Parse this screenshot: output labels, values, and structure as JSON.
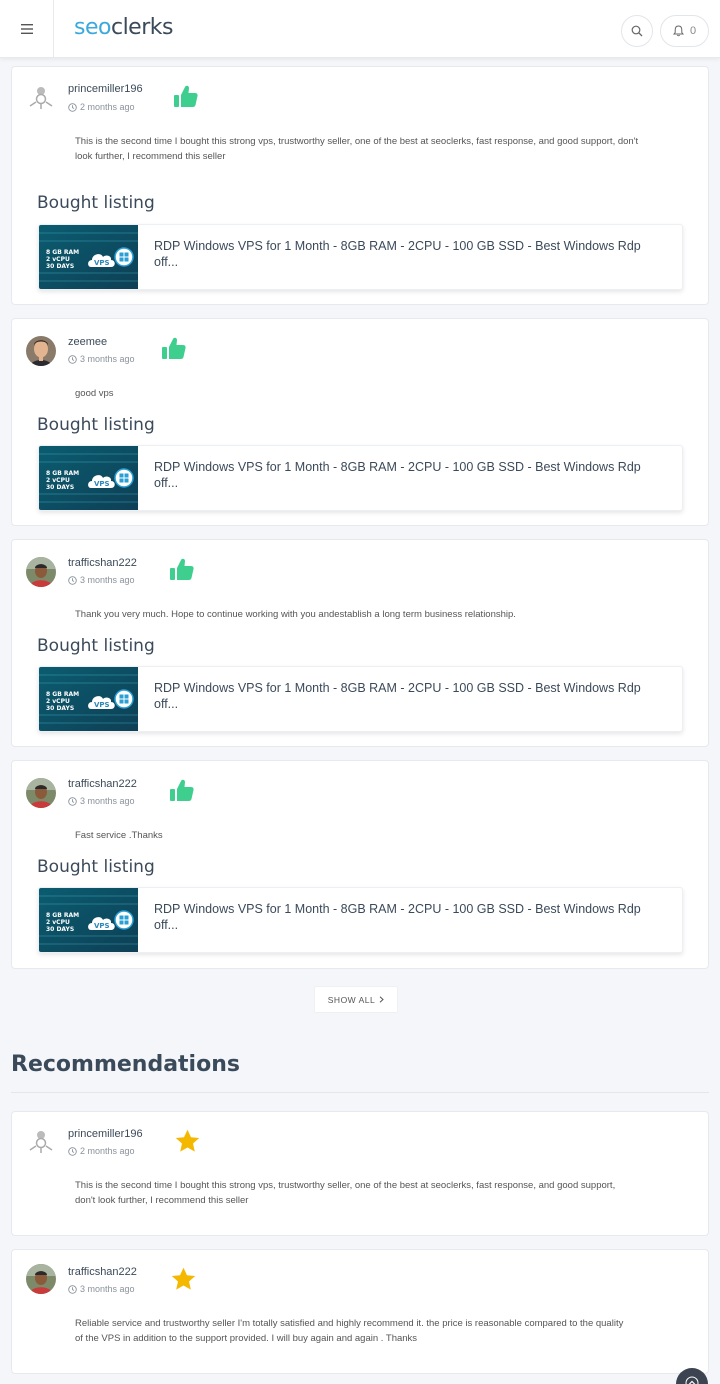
{
  "header": {
    "logo_seo": "seo",
    "logo_clerks": "clerks",
    "notification_count": "0",
    "menu_icon": "hamburger-icon",
    "search_icon": "search-icon",
    "bell_icon": "bell-icon"
  },
  "reviews": [
    {
      "username": "princemiller196",
      "time": "2 months ago",
      "text_line1": "This is the second time I bought this strong vps, trustworthy seller, one of the best at seoclerks, fast response, and good support, don't",
      "text_line2": "look further, I recommend this seller",
      "bought_label": "Bought listing",
      "listing_title": "RDP Windows VPS for 1 Month - 8GB RAM - 2CPU - 100 GB SSD - Best Windows Rdp off..."
    },
    {
      "username": "zeemee",
      "time": "3 months ago",
      "text_line1": "good vps",
      "bought_label": "Bought listing",
      "listing_title": "RDP Windows VPS for 1 Month - 8GB RAM - 2CPU - 100 GB SSD - Best Windows Rdp off..."
    },
    {
      "username": "trafficshan222",
      "time": "3 months ago",
      "text_line1": "Thank you very much. Hope to continue working with you andestablish a long term business relationship.",
      "bought_label": "Bought listing",
      "listing_title": "RDP Windows VPS for 1 Month - 8GB RAM - 2CPU - 100 GB SSD - Best Windows Rdp off..."
    },
    {
      "username": "trafficshan222",
      "time": "3 months ago",
      "text_line1": "Fast service .Thanks",
      "bought_label": "Bought listing",
      "listing_title": "RDP Windows VPS for 1 Month - 8GB RAM - 2CPU - 100 GB SSD - Best Windows Rdp off..."
    }
  ],
  "listing_thumb": {
    "ram": "8 GB RAM",
    "cpu": "2 vCPU",
    "days": "30 DAYS",
    "badge": "VPS"
  },
  "show_all_label": "SHOW ALL",
  "recommendations_title": "Recommendations",
  "recommendations": [
    {
      "username": "princemiller196",
      "time": "2 months ago",
      "text_line1": "This is the second time I bought this strong vps, trustworthy seller, one of the best at seoclerks, fast response, and good support,",
      "text_line2": "don't look further, I recommend this seller"
    },
    {
      "username": "trafficshan222",
      "time": "3 months ago",
      "text_line1": "Reliable service and trustworthy seller I'm totally satisfied and  highly recommend it. the price is reasonable compared to the quality",
      "text_line2": "of the VPS in addition to the support provided. I will buy again and again . Thanks"
    }
  ],
  "colors": {
    "accent_blue": "#3aa9dd",
    "thumb_green": "#3ecf8e",
    "star_yellow": "#f5b800",
    "text_dark": "#3b4a5a"
  }
}
